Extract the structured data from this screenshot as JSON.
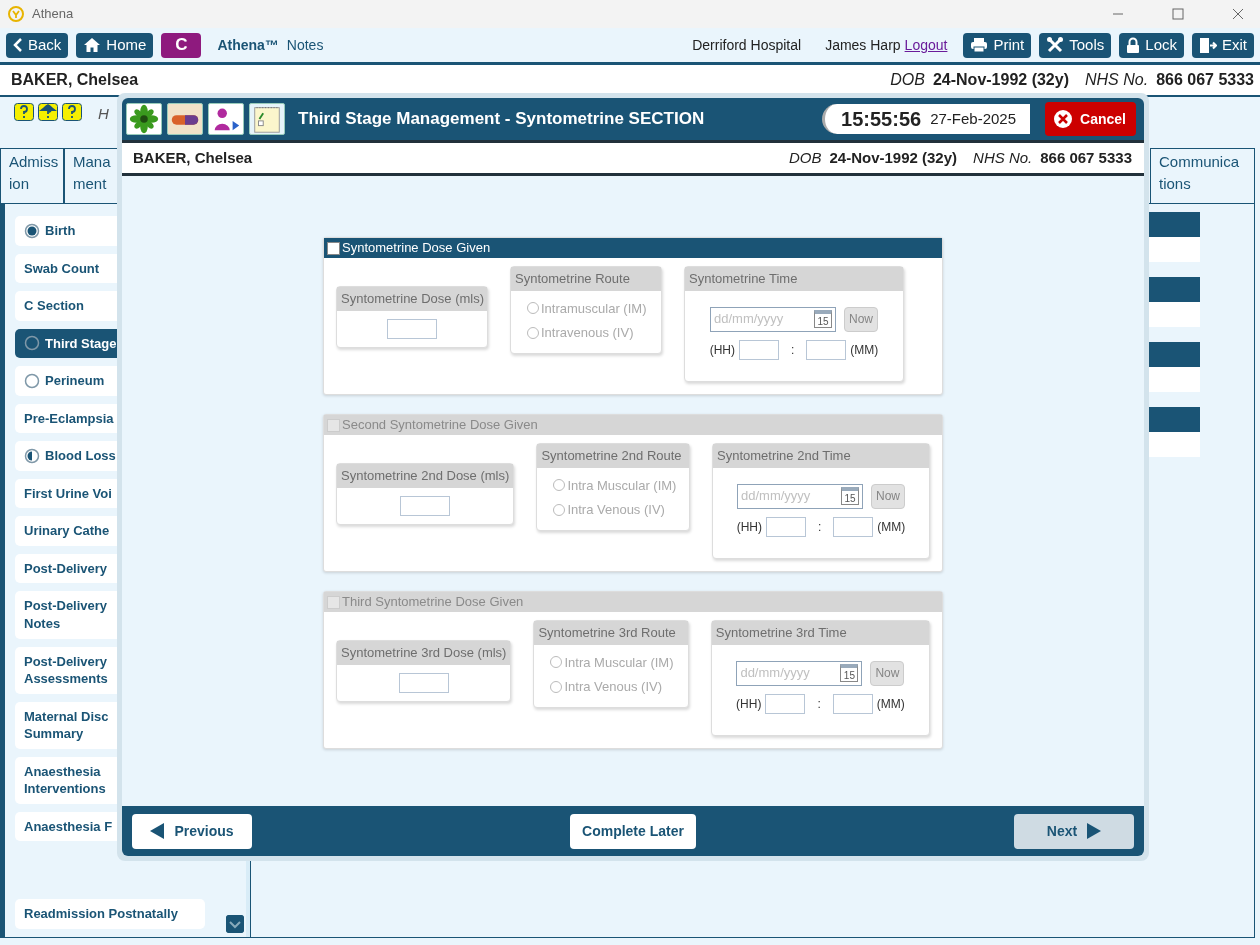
{
  "app": {
    "title": "Athena"
  },
  "toolbar": {
    "nav": [
      {
        "label": "Back"
      },
      {
        "label": "Home"
      }
    ],
    "context_badge": "C",
    "brand": "Athena™",
    "module": "Notes",
    "hospital": "Derriford Hospital",
    "user": "James Harp",
    "logout": "Logout",
    "actions": [
      {
        "label": "Print"
      },
      {
        "label": "Tools"
      },
      {
        "label": "Lock"
      },
      {
        "label": "Exit"
      }
    ]
  },
  "patient": {
    "name": "BAKER, Chelsea",
    "dob_label": "DOB",
    "dob": "24-Nov-1992 (32y)",
    "nhs_label": "NHS No.",
    "nhs": "866 067 5333"
  },
  "hint_text": "H",
  "tabs": [
    {
      "label": "Admiss\nion",
      "selected": false
    },
    {
      "label": "Mana\nment",
      "selected": false
    },
    {
      "label": "Communica\ntions",
      "selected": false
    }
  ],
  "sidebar": {
    "items": [
      {
        "label": "Birth",
        "selected": false,
        "kind": "complete"
      },
      {
        "label": "Swab Count",
        "selected": false
      },
      {
        "label": "C Section",
        "selected": false
      },
      {
        "label": "Third Stage",
        "selected": true,
        "kind": "empty"
      },
      {
        "label": "Perineum",
        "selected": false,
        "kind": "empty"
      },
      {
        "label": "Pre-Eclampsia",
        "selected": false
      },
      {
        "label": "Blood Loss",
        "selected": false,
        "kind": "partial"
      },
      {
        "label": "First Urine Voi",
        "selected": false
      },
      {
        "label": "Urinary Cathe",
        "selected": false
      },
      {
        "label": "Post-Delivery",
        "selected": false
      },
      {
        "label": "Post-Delivery\nNotes",
        "selected": false
      },
      {
        "label": "Post-Delivery\nAssessments",
        "selected": false
      },
      {
        "label": "Maternal Disc\nSummary",
        "selected": false
      },
      {
        "label": "Anaesthesia\nInterventions",
        "selected": false
      },
      {
        "label": "Anaesthesia F",
        "selected": false
      },
      {
        "label": "Readmission Postnatally",
        "selected": false
      }
    ]
  },
  "dialog": {
    "title": "Third Stage Management - Syntometrine SECTION",
    "time": "15:55:56",
    "date": "27-Feb-2025",
    "cancel": "Cancel",
    "patient": {
      "name": "BAKER, Chelsea",
      "dob_label": "DOB",
      "dob": "24-Nov-1992 (32y)",
      "nhs_label": "NHS No.",
      "nhs": "866 067 5333"
    },
    "sections": [
      {
        "title": "Syntometrine Dose Given",
        "checked": false,
        "disabled": false,
        "dose_title": "Syntometrine Dose (mls)",
        "route_title": "Syntometrine Route",
        "route_options": [
          {
            "label": "Intramuscular (IM)",
            "selected": false
          },
          {
            "label": "Intravenous (IV)",
            "selected": false
          }
        ],
        "time_title": "Syntometrine Time",
        "date_placeholder": "dd/mm/yyyy",
        "calendar_day": "15",
        "now": "Now",
        "hh": "(HH)",
        "separator": ":",
        "mm": "(MM)"
      },
      {
        "title": "Second Syntometrine Dose Given",
        "checked": false,
        "disabled": true,
        "dose_title": "Syntometrine 2nd Dose (mls)",
        "route_title": "Syntometrine 2nd Route",
        "route_options": [
          {
            "label": "Intra Muscular (IM)",
            "selected": false
          },
          {
            "label": "Intra Venous (IV)",
            "selected": false
          }
        ],
        "time_title": "Syntometrine 2nd Time",
        "date_placeholder": "dd/mm/yyyy",
        "calendar_day": "15",
        "now": "Now",
        "hh": "(HH)",
        "separator": ":",
        "mm": "(MM)"
      },
      {
        "title": "Third Syntometrine Dose Given",
        "checked": false,
        "disabled": true,
        "dose_title": "Syntometrine 3rd Dose (mls)",
        "route_title": "Syntometrine 3rd Route",
        "route_options": [
          {
            "label": "Intra Muscular (IM)",
            "selected": false
          },
          {
            "label": "Intra Venous (IV)",
            "selected": false
          }
        ],
        "time_title": "Syntometrine 3rd Time",
        "date_placeholder": "dd/mm/yyyy",
        "calendar_day": "15",
        "now": "Now",
        "hh": "(HH)",
        "separator": ":",
        "mm": "(MM)"
      }
    ],
    "footer": {
      "previous": "Previous",
      "complete_later": "Complete Later",
      "next": "Next",
      "next_disabled": true
    }
  }
}
